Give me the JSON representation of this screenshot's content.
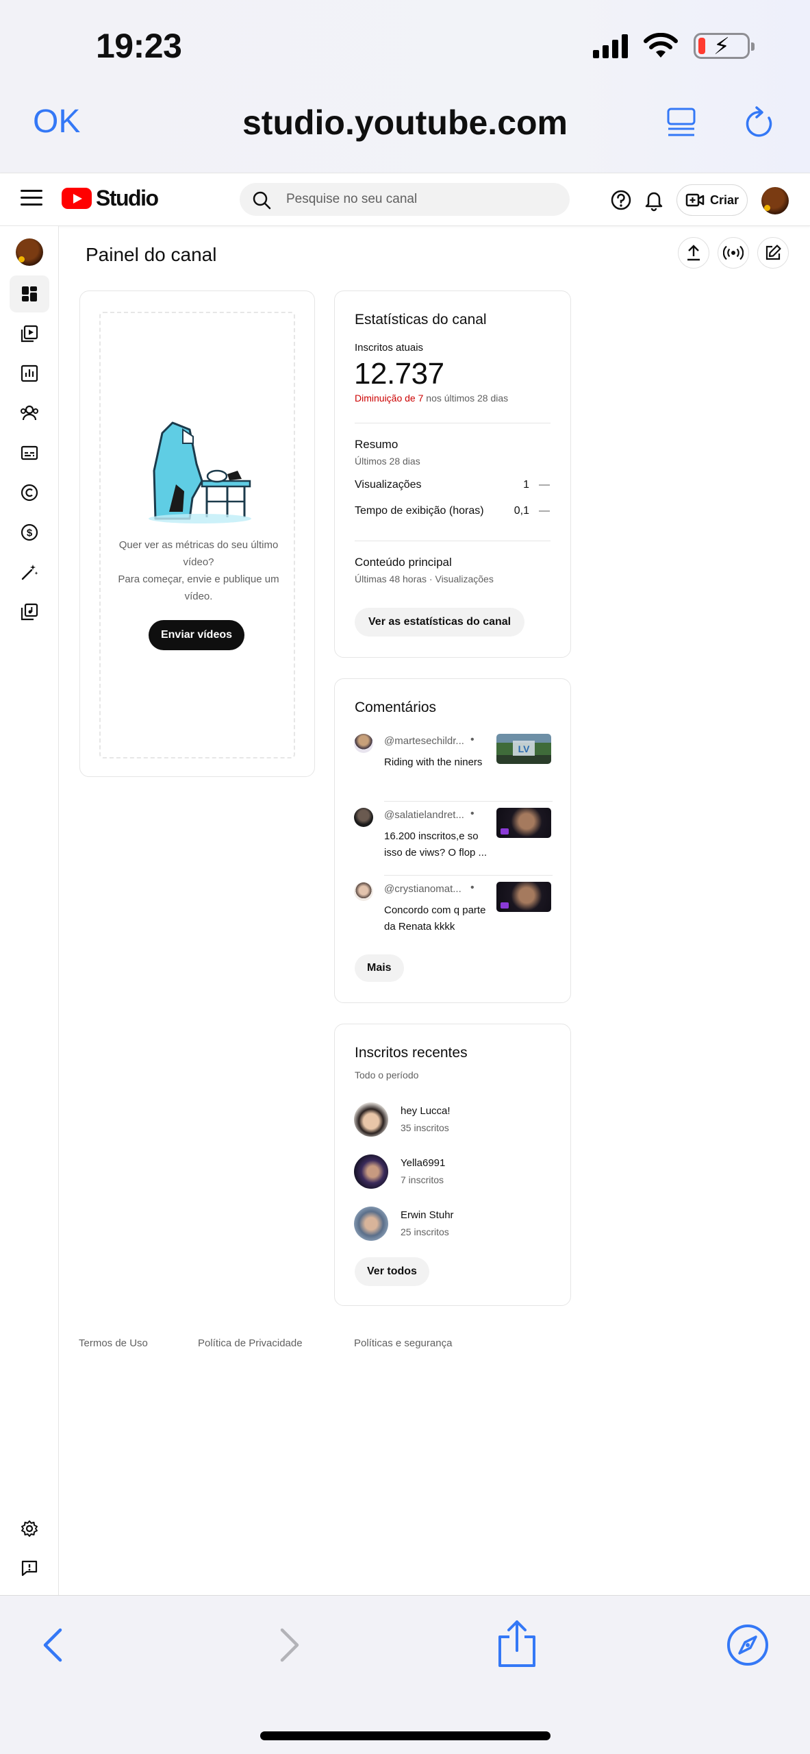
{
  "status_bar": {
    "time": "19:23"
  },
  "browser": {
    "done_label": "OK",
    "url": "studio.youtube.com"
  },
  "header": {
    "logo_text": "Studio",
    "search_placeholder": "Pesquise no seu canal",
    "create_label": "Criar"
  },
  "sidebar": {
    "items": [
      {
        "icon": "dashboard-icon",
        "active": true
      },
      {
        "icon": "content-icon"
      },
      {
        "icon": "analytics-icon"
      },
      {
        "icon": "community-icon"
      },
      {
        "icon": "subtitles-icon"
      },
      {
        "icon": "copyright-icon"
      },
      {
        "icon": "earn-icon"
      },
      {
        "icon": "customization-icon"
      },
      {
        "icon": "audio-library-icon"
      }
    ],
    "bottom_items": [
      {
        "icon": "settings-icon"
      },
      {
        "icon": "feedback-icon"
      }
    ]
  },
  "page": {
    "title": "Painel do canal"
  },
  "upload_card": {
    "text_line1": "Quer ver as métricas do seu último vídeo?",
    "text_line2": "Para começar, envie e publique um vídeo.",
    "button_label": "Enviar vídeos"
  },
  "stats_card": {
    "title": "Estatísticas do canal",
    "subscribers_label": "Inscritos atuais",
    "subscribers_value": "12.737",
    "delta_red": "Diminuição de 7",
    "delta_rest": " nos últimos 28 dias",
    "summary_title": "Resumo",
    "summary_period": "Últimos 28 dias",
    "rows": [
      {
        "label": "Visualizações",
        "value": "1",
        "trend": "—"
      },
      {
        "label": "Tempo de exibição (horas)",
        "value": "0,1",
        "trend": "—"
      }
    ],
    "top_content_title": "Conteúdo principal",
    "top_content_sub": "Últimas 48 horas · Visualizações",
    "button_label": "Ver as estatísticas do canal"
  },
  "comments_card": {
    "title": "Comentários",
    "items": [
      {
        "user": "@martesechildr...",
        "dot": "•",
        "text": "Riding with the niners"
      },
      {
        "user": "@salatielandret...",
        "dot": "•",
        "text": "16.200 inscritos,e so isso de viws? O flop ..."
      },
      {
        "user": "@crystianomat...",
        "dot": "•",
        "text": "Concordo com q parte da Renata kkkk"
      }
    ],
    "more_label": "Mais"
  },
  "subscribers_card": {
    "title": "Inscritos recentes",
    "period": "Todo o período",
    "items": [
      {
        "name": "hey Lucca!",
        "count": "35 inscritos"
      },
      {
        "name": "Yella6991",
        "count": "7 inscritos"
      },
      {
        "name": "Erwin Stuhr",
        "count": "25 inscritos"
      }
    ],
    "see_all_label": "Ver todos"
  },
  "footer": {
    "terms": "Termos de Uso",
    "privacy": "Política de Privacidade",
    "policies": "Políticas e segurança"
  },
  "colors": {
    "accent_ios": "#3478f6",
    "youtube_red": "#ff0000",
    "decrease_red": "#cc0000"
  }
}
